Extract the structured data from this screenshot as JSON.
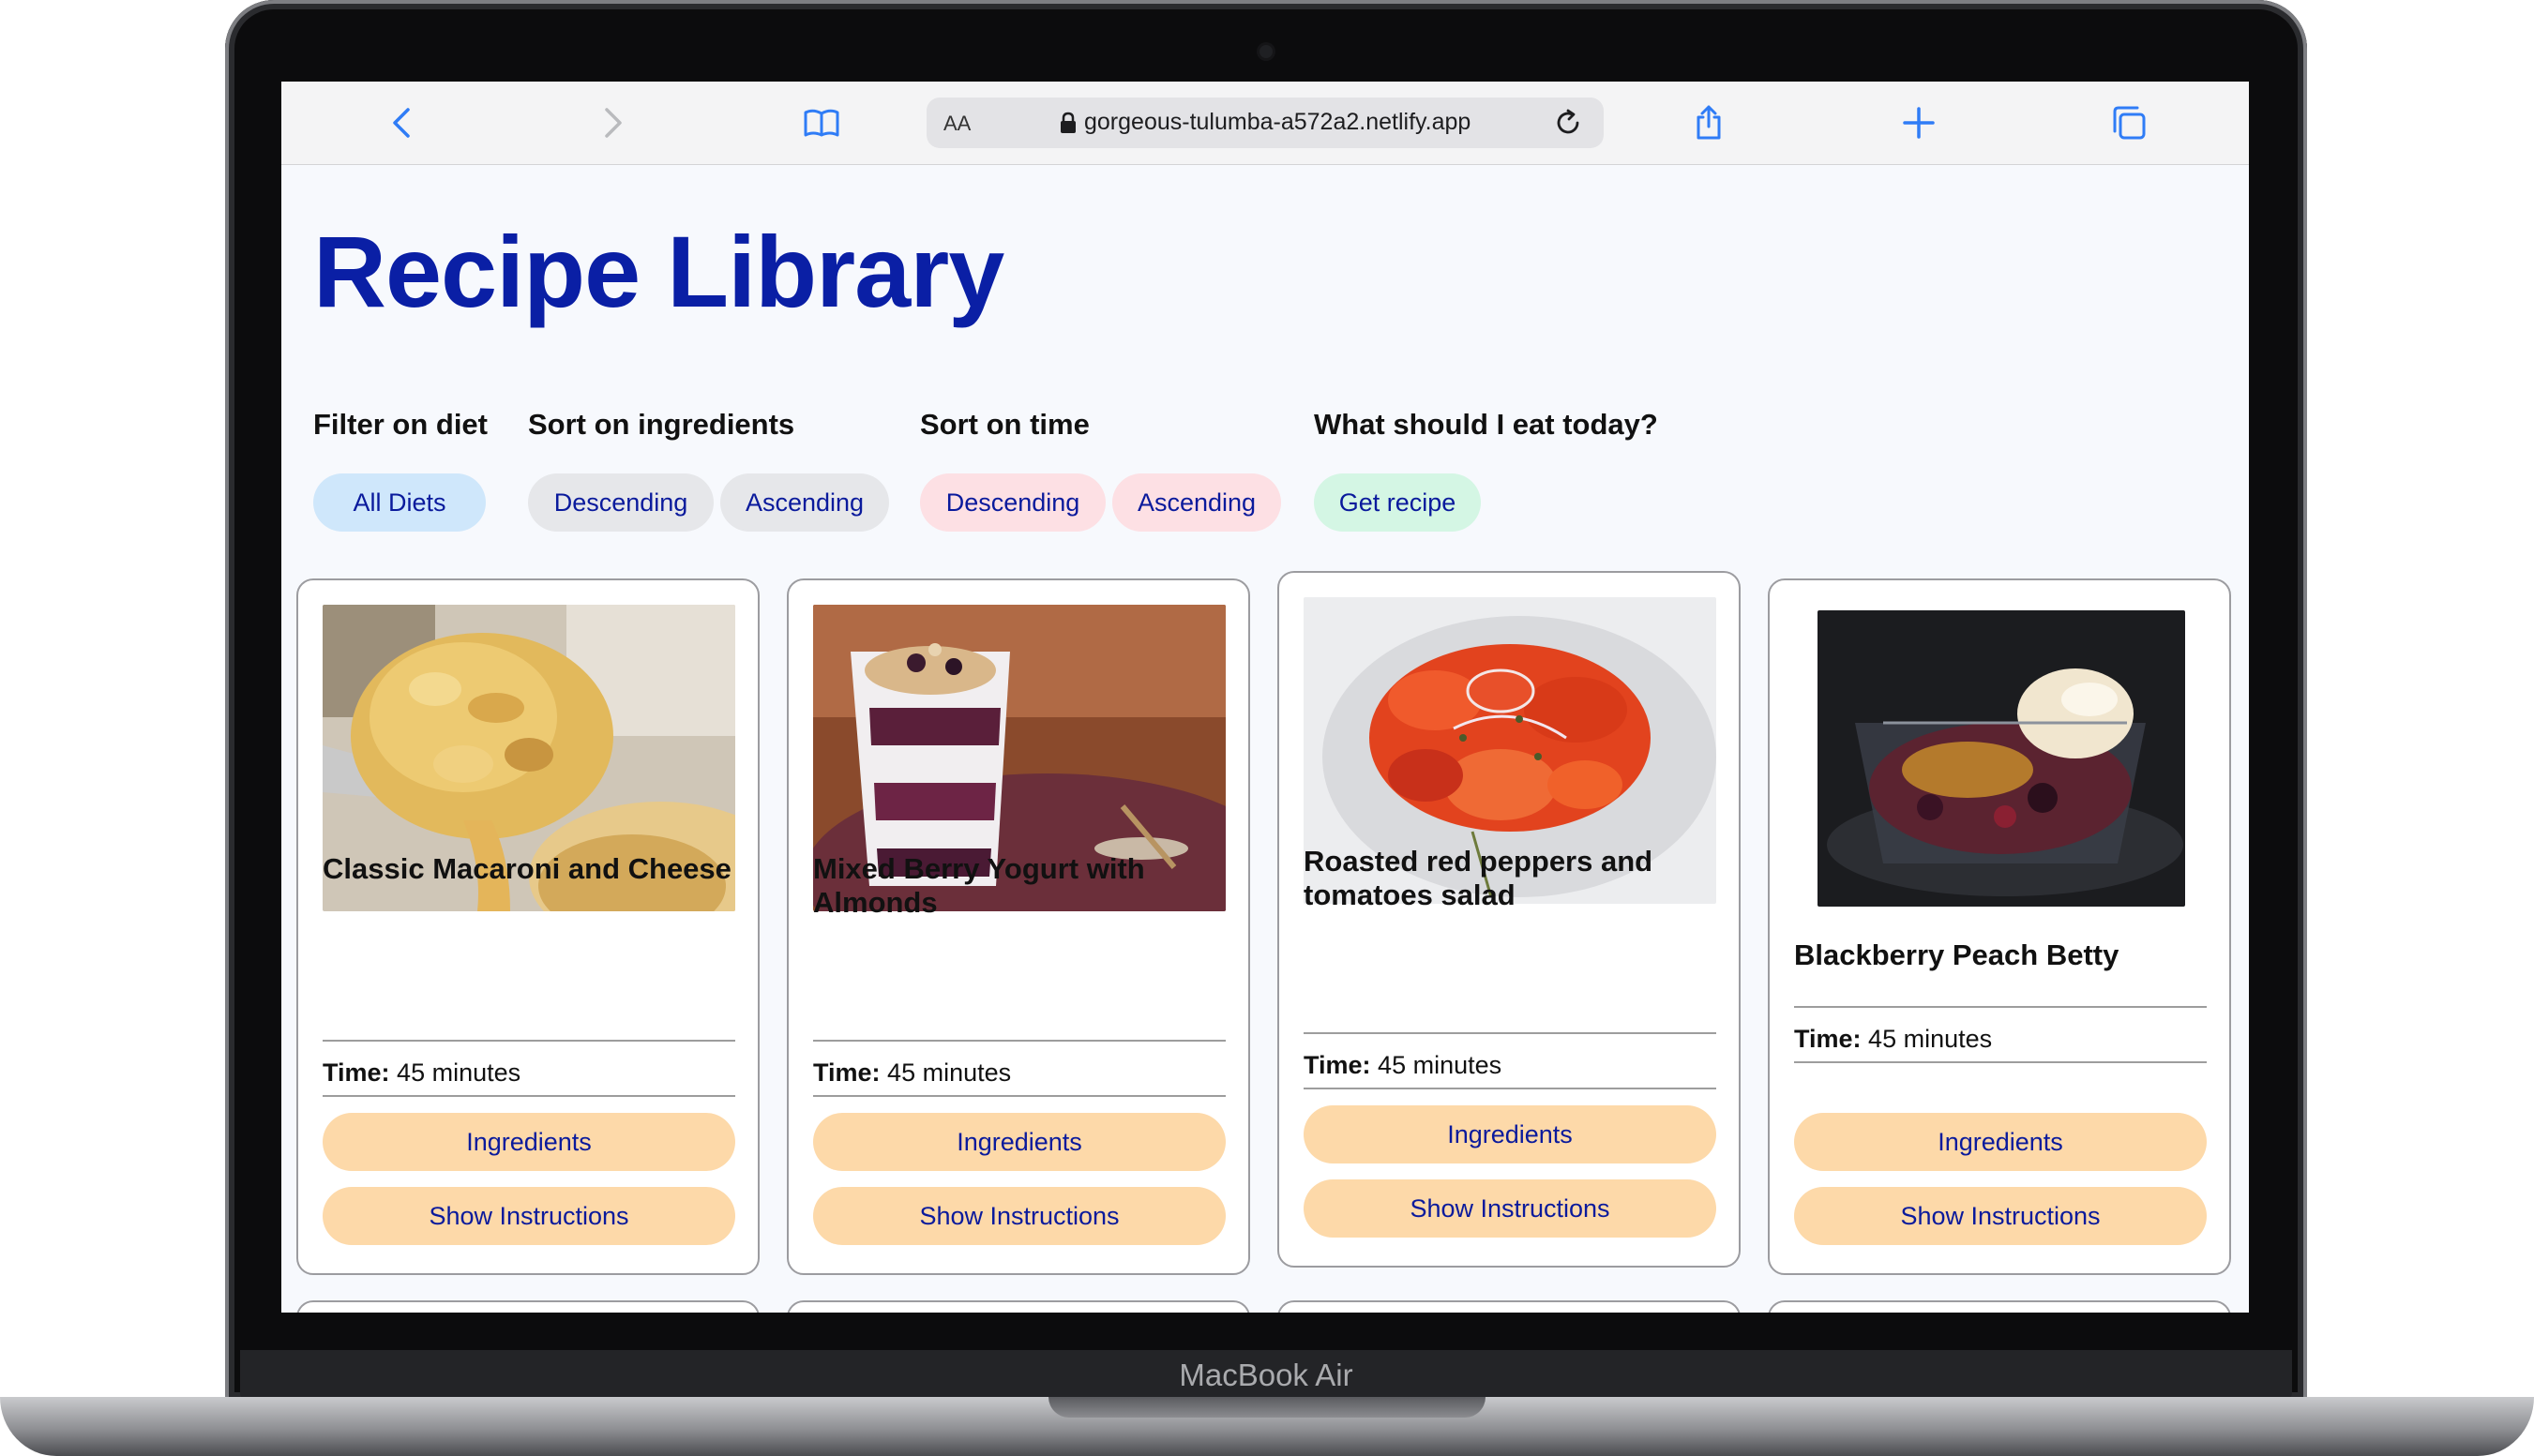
{
  "device": {
    "label": "MacBook Air"
  },
  "browser": {
    "aa_label": "AA",
    "url": "gorgeous-tulumba-a572a2.netlify.app"
  },
  "page": {
    "title": "Recipe Library",
    "filters": [
      {
        "heading": "Filter on diet",
        "buttons": [
          "All Diets"
        ]
      },
      {
        "heading": "Sort on ingredients",
        "buttons": [
          "Descending",
          "Ascending"
        ]
      },
      {
        "heading": "Sort on time",
        "buttons": [
          "Descending",
          "Ascending"
        ]
      },
      {
        "heading": "What should I eat today?",
        "buttons": [
          "Get recipe"
        ]
      }
    ],
    "colors": {
      "title": "#0a1fa5",
      "chip_diet": "#cfe7fb",
      "chip_ingredients": "#e6e7ea",
      "chip_time": "#fde0e4",
      "chip_random": "#d4f6e4",
      "card_button": "#fdd9a9"
    },
    "recipes": [
      {
        "name": "Classic Macaroni and Cheese",
        "time_label": "Time:",
        "time_value": "45 minutes",
        "ingredients_label": "Ingredients",
        "instructions_label": "Show Instructions",
        "image": "macaroni-photo"
      },
      {
        "name": "Mixed Berry Yogurt with Almonds",
        "time_label": "Time:",
        "time_value": "45 minutes",
        "ingredients_label": "Ingredients",
        "instructions_label": "Show Instructions",
        "image": "berry-yogurt-photo"
      },
      {
        "name": "Roasted red peppers and tomatoes salad",
        "time_label": "Time:",
        "time_value": "45 minutes",
        "ingredients_label": "Ingredients",
        "instructions_label": "Show Instructions",
        "image": "pepper-salad-photo"
      },
      {
        "name": "Blackberry Peach Betty",
        "time_label": "Time:",
        "time_value": "45 minutes",
        "ingredients_label": "Ingredients",
        "instructions_label": "Show Instructions",
        "image": "peach-betty-photo"
      }
    ]
  }
}
